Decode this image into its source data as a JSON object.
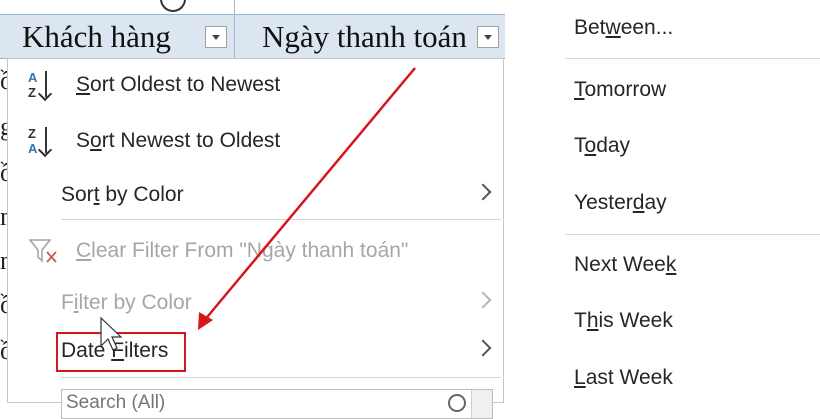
{
  "sheet": {
    "headers": [
      {
        "label": "Khách hàng"
      },
      {
        "label": "Ngày thanh toán"
      }
    ],
    "row_stubs": [
      "ồ",
      "g",
      "ồ",
      "n",
      "n",
      "ồ",
      "ồ"
    ]
  },
  "menu": {
    "items": [
      {
        "label": "Sort Oldest to Newest",
        "icon": "sort-ascending-icon",
        "icon_letters": [
          "A",
          "Z"
        ],
        "underline": "S",
        "enabled": true
      },
      {
        "label": "Sort Newest to Oldest",
        "icon": "sort-descending-icon",
        "icon_letters": [
          "Z",
          "A"
        ],
        "underline": "o",
        "enabled": true
      },
      {
        "label": "Sort by Color",
        "icon": "",
        "underline": "t",
        "enabled": true,
        "submenu": true
      },
      {
        "label": "Clear Filter From \"Ngày thanh toán\"",
        "icon": "clear-filter-icon",
        "underline": "C",
        "enabled": false
      },
      {
        "label": "Filter by Color",
        "icon": "",
        "underline": "i",
        "enabled": false,
        "submenu": true
      },
      {
        "label": "Date Filters",
        "icon": "",
        "underline": "F",
        "enabled": true,
        "submenu": true,
        "highlighted": true
      }
    ],
    "search_placeholder": "Search (All)"
  },
  "submenu": {
    "items": [
      {
        "label": "Between...",
        "underline": "w"
      },
      {
        "label": "Tomorrow",
        "underline": "T"
      },
      {
        "label": "Today",
        "underline": "o"
      },
      {
        "label": "Yesterday",
        "underline": "d"
      },
      {
        "label": "Next Week",
        "underline": "k"
      },
      {
        "label": "This Week",
        "underline": "h"
      },
      {
        "label": "Last Week",
        "underline": "L"
      }
    ]
  },
  "colors": {
    "header_bg": "#dce6f1",
    "highlight_red": "#d6161d",
    "disabled_text": "#a6a6a6",
    "sort_blue": "#2e75b6"
  }
}
